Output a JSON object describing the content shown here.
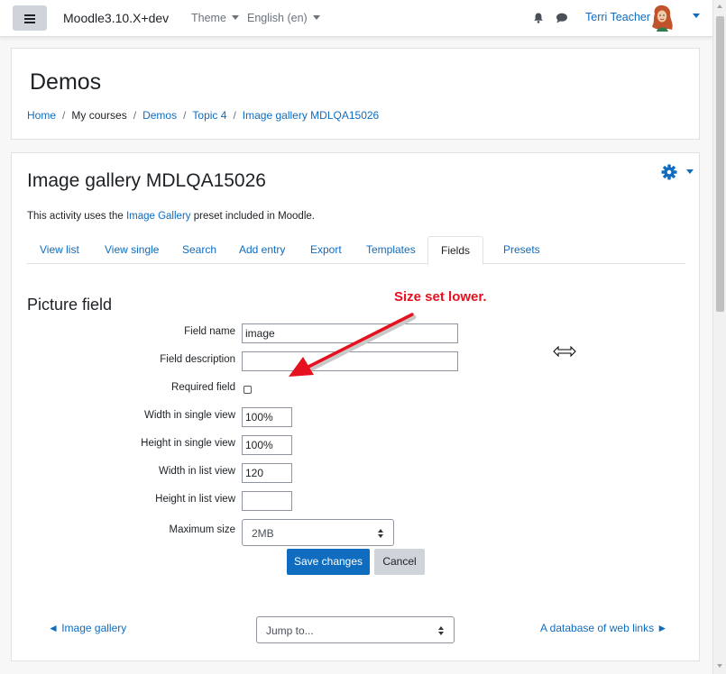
{
  "navbar": {
    "brand": "Moodle3.10.X+dev",
    "theme_menu": "Theme",
    "language_menu": "English ‎(en)‎",
    "user_name": "Terri Teacher"
  },
  "header": {
    "title": "Demos",
    "breadcrumb": [
      "Home",
      "My courses",
      "Demos",
      "Topic 4",
      "Image gallery MDLQA15026"
    ]
  },
  "activity": {
    "title": "Image gallery MDLQA15026",
    "intro_before": "This activity uses the ",
    "intro_link": "Image Gallery",
    "intro_after": " preset included in Moodle."
  },
  "tabs": [
    {
      "label": "View list",
      "active": false
    },
    {
      "label": "View single",
      "active": false
    },
    {
      "label": "Search",
      "active": false
    },
    {
      "label": "Add entry",
      "active": false
    },
    {
      "label": "Export",
      "active": false
    },
    {
      "label": "Templates",
      "active": false
    },
    {
      "label": "Fields",
      "active": true
    },
    {
      "label": "Presets",
      "active": false
    }
  ],
  "form": {
    "section_title": "Picture field",
    "field_name_label": "Field name",
    "field_name_value": "image",
    "field_description_label": "Field description",
    "field_description_value": "",
    "required_label": "Required field",
    "required_checked": false,
    "width_single_label": "Width in single view",
    "width_single_value": "100%",
    "height_single_label": "Height in single view",
    "height_single_value": "100%",
    "width_list_label": "Width in list view",
    "width_list_value": "120",
    "height_list_label": "Height in list view",
    "height_list_value": "",
    "max_size_label": "Maximum size",
    "max_size_value": "2MB",
    "save_label": "Save changes",
    "cancel_label": "Cancel"
  },
  "annotation": {
    "text": "Size set lower.",
    "color": "#e6111e"
  },
  "footer_nav": {
    "prev_label": "◄ Image gallery",
    "jump_label": "Jump to...",
    "next_label": "A database of web links ►"
  },
  "colors": {
    "link": "#0f6cbf",
    "primary_button": "#0f6cbf",
    "secondary_button": "#ced4da",
    "page_background": "#f7f7f7"
  }
}
